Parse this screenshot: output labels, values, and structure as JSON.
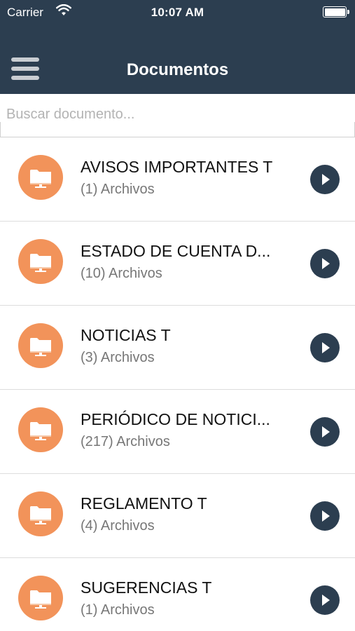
{
  "status_bar": {
    "carrier": "Carrier",
    "time": "10:07 AM",
    "wifi_icon": "wifi-icon",
    "battery_icon": "battery-full-icon"
  },
  "header": {
    "title": "Documentos",
    "menu_icon": "hamburger-menu-icon",
    "background_color": "#2c3e50"
  },
  "search": {
    "placeholder": "Buscar documento...",
    "value": ""
  },
  "documents": [
    {
      "name": "AVISOS IMPORTANTES T",
      "count": "(1) Archivos"
    },
    {
      "name": "ESTADO DE CUENTA D...",
      "count": "(10) Archivos"
    },
    {
      "name": "NOTICIAS T",
      "count": "(3) Archivos"
    },
    {
      "name": "PERIÓDICO DE NOTICI...",
      "count": "(217) Archivos"
    },
    {
      "name": "REGLAMENTO T",
      "count": "(4) Archivos"
    },
    {
      "name": "SUGERENCIAS T",
      "count": "(1) Archivos"
    }
  ],
  "colors": {
    "folder_accent": "#f2935a",
    "arrow_button": "#2c3e50"
  },
  "icons": {
    "folder": "folder-icon",
    "arrow": "chevron-right-circle-icon"
  }
}
